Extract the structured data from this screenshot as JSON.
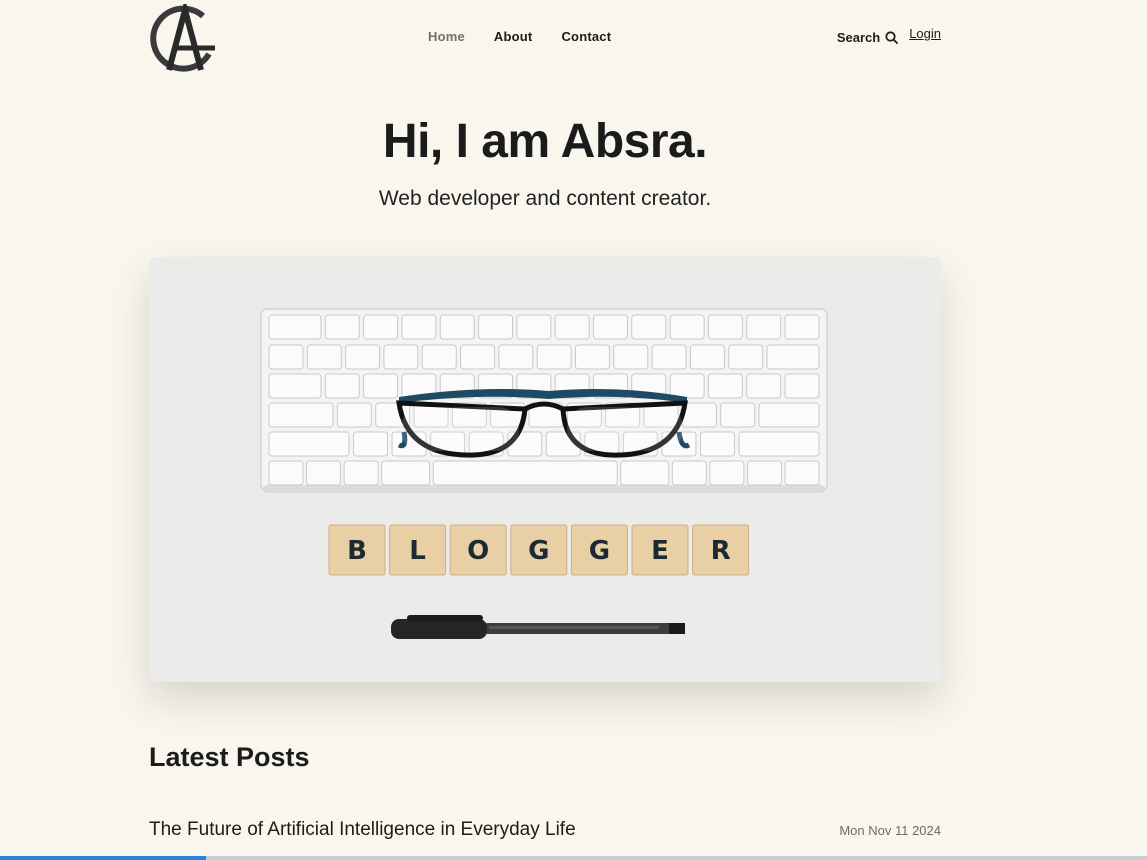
{
  "header": {
    "logo_letters": "AG",
    "nav": [
      {
        "label": "Home",
        "active": true
      },
      {
        "label": "About",
        "active": false
      },
      {
        "label": "Contact",
        "active": false
      }
    ],
    "search_label": "Search",
    "login_label": "Login"
  },
  "hero": {
    "title": "Hi, I am Absra.",
    "subtitle": "Web developer and content creator.",
    "image": {
      "tiles": [
        "B",
        "L",
        "O",
        "G",
        "G",
        "E",
        "R"
      ]
    }
  },
  "latest_posts": {
    "title": "Latest Posts",
    "posts": [
      {
        "title": "The Future of Artificial Intelligence in Everyday Life",
        "date": "Mon Nov 11 2024"
      }
    ]
  },
  "page_load_progress": 0.18,
  "colors": {
    "background": "#f9f7ed",
    "text": "#1c1c1c",
    "muted": "#6f6f6f",
    "progress": "#2b82d6"
  }
}
